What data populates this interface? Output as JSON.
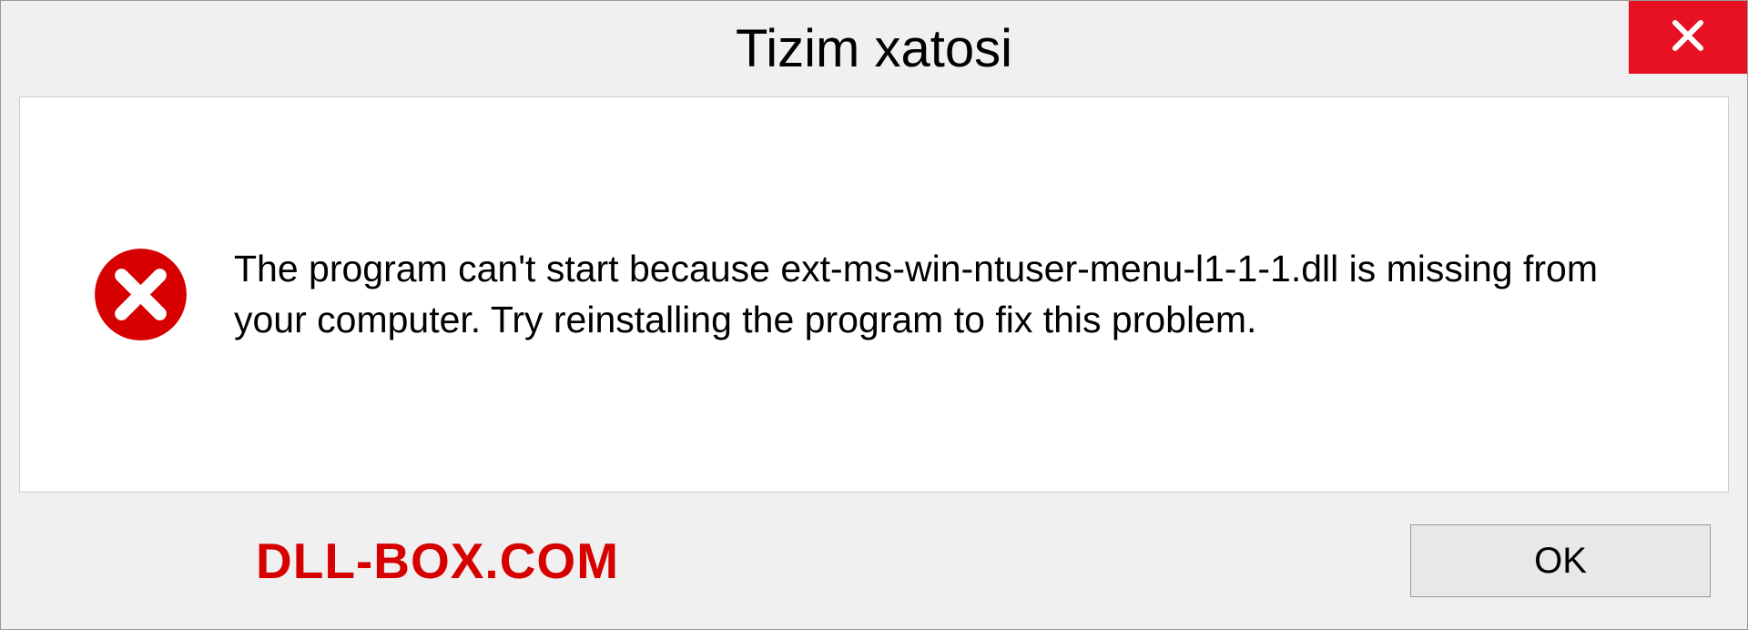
{
  "dialog": {
    "title": "Tizim xatosi",
    "message": "The program can't start because ext-ms-win-ntuser-menu-l1-1-1.dll is missing from your computer. Try reinstalling the program to fix this problem.",
    "ok_label": "OK"
  },
  "watermark": "DLL-BOX.COM"
}
